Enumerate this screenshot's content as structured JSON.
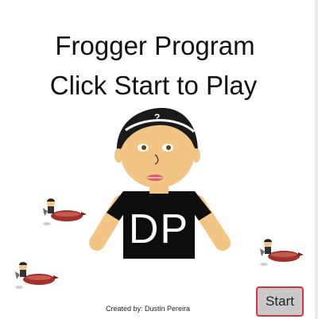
{
  "title_line1": "Frogger Program",
  "title_line2": "Click Start to Play",
  "avatar_shirt_text": "DP",
  "credit": "Created by: Dustin Pereira",
  "start_label": "Start",
  "colors": {
    "skin": "#f2c584",
    "hair": "#1a1a1a",
    "shirt": "#0d0d0d",
    "button_border": "#d9343e",
    "button_fill": "#c9c9c9"
  }
}
